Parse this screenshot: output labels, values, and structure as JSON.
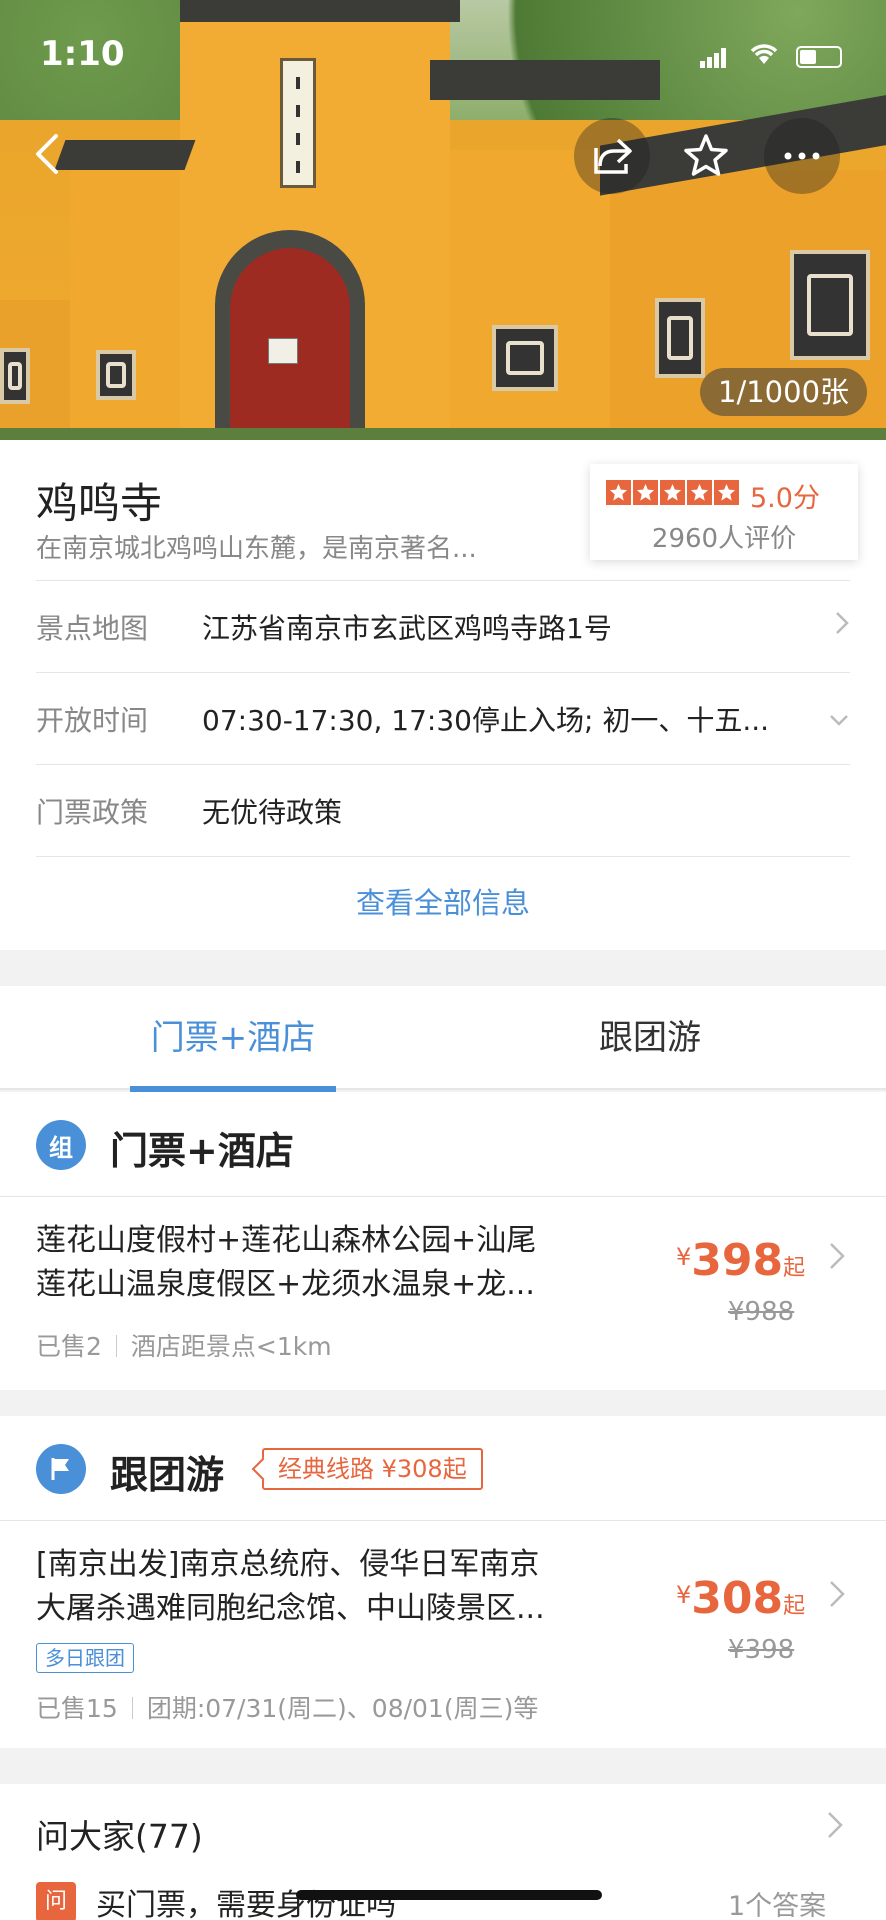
{
  "status_bar": {
    "time": "1:10"
  },
  "hero": {
    "photo_count": "1/1000张"
  },
  "attraction": {
    "name": "鸡鸣寺",
    "description": "在南京城北鸡鸣山东麓，是南京著名...",
    "rating_score": "5.0分",
    "rating_stars": 5,
    "review_count": "2960人评价"
  },
  "info_rows": [
    {
      "label": "景点地图",
      "value": "江苏省南京市玄武区鸡鸣寺路1号"
    },
    {
      "label": "开放时间",
      "value": "07:30-17:30, 17:30停止入场; 初一、十五..."
    },
    {
      "label": "门票政策",
      "value": "无优待政策"
    }
  ],
  "view_all": "查看全部信息",
  "tabs": [
    {
      "label": "门票+酒店"
    },
    {
      "label": "跟团游"
    }
  ],
  "section_ticket_hotel": {
    "icon_text": "组",
    "title": "门票+酒店",
    "item": {
      "title_line1": "莲花山度假村+莲花山森林公园+汕尾",
      "title_line2": "莲花山温泉度假区+龙须水温泉+龙...",
      "currency": "¥",
      "price": "398",
      "price_suffix": "起",
      "original_price": "¥988",
      "sold": "已售2",
      "distance": "酒店距景点<1km"
    }
  },
  "section_tour": {
    "title": "跟团游",
    "badge": "经典线路 ¥308起",
    "item": {
      "title_line1": "[南京出发]南京总统府、侵华日军南京",
      "title_line2": "大屠杀遇难同胞纪念馆、中山陵景区...",
      "tag": "多日跟团",
      "currency": "¥",
      "price": "308",
      "price_suffix": "起",
      "original_price": "¥398",
      "sold": "已售15",
      "schedule": "团期:07/31(周二)、08/01(周三)等"
    }
  },
  "ask": {
    "title": "问大家(77)",
    "q_icon": "问",
    "question": "买门票，需要身份证吗",
    "answers": "1个答案"
  },
  "colors": {
    "accent": "#4a90d9",
    "price": "#e8663d"
  }
}
